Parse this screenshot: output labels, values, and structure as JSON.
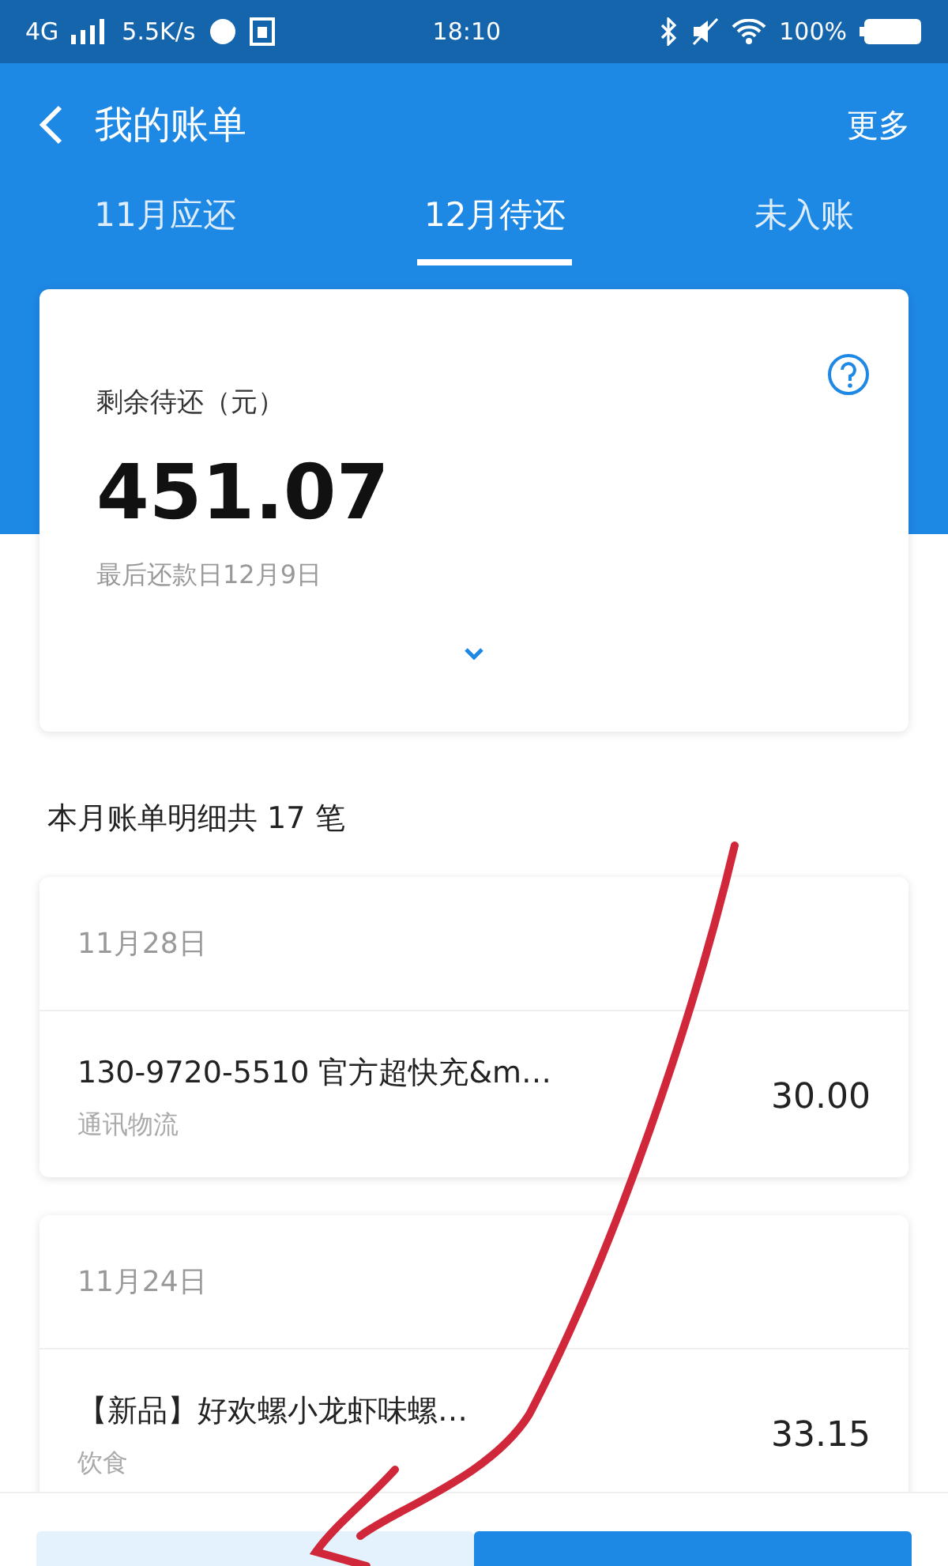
{
  "status_bar": {
    "network": "4G",
    "speed": "5.5K/s",
    "time": "18:10",
    "battery": "100%"
  },
  "header": {
    "title": "我的账单",
    "more": "更多"
  },
  "tabs": [
    {
      "label": "11月应还",
      "selected": false
    },
    {
      "label": "12月待还",
      "selected": true
    },
    {
      "label": "未入账",
      "selected": false
    }
  ],
  "summary": {
    "label": "剩余待还（元）",
    "amount": "451.07",
    "due": "最后还款日12月9日"
  },
  "detail_count": "本月账单明细共 17 笔",
  "groups": [
    {
      "date": "11月28日",
      "items": [
        {
          "title": "130-9720-5510  官方超快充&m…",
          "category": "通讯物流",
          "amount": "30.00"
        }
      ]
    },
    {
      "date": "11月24日",
      "items": [
        {
          "title": "【新品】好欢螺小龙虾味螺…",
          "category": "饮食",
          "amount": "33.15"
        }
      ]
    }
  ],
  "bottom_buttons": [
    {
      "kind": "secondary"
    },
    {
      "kind": "primary"
    }
  ]
}
